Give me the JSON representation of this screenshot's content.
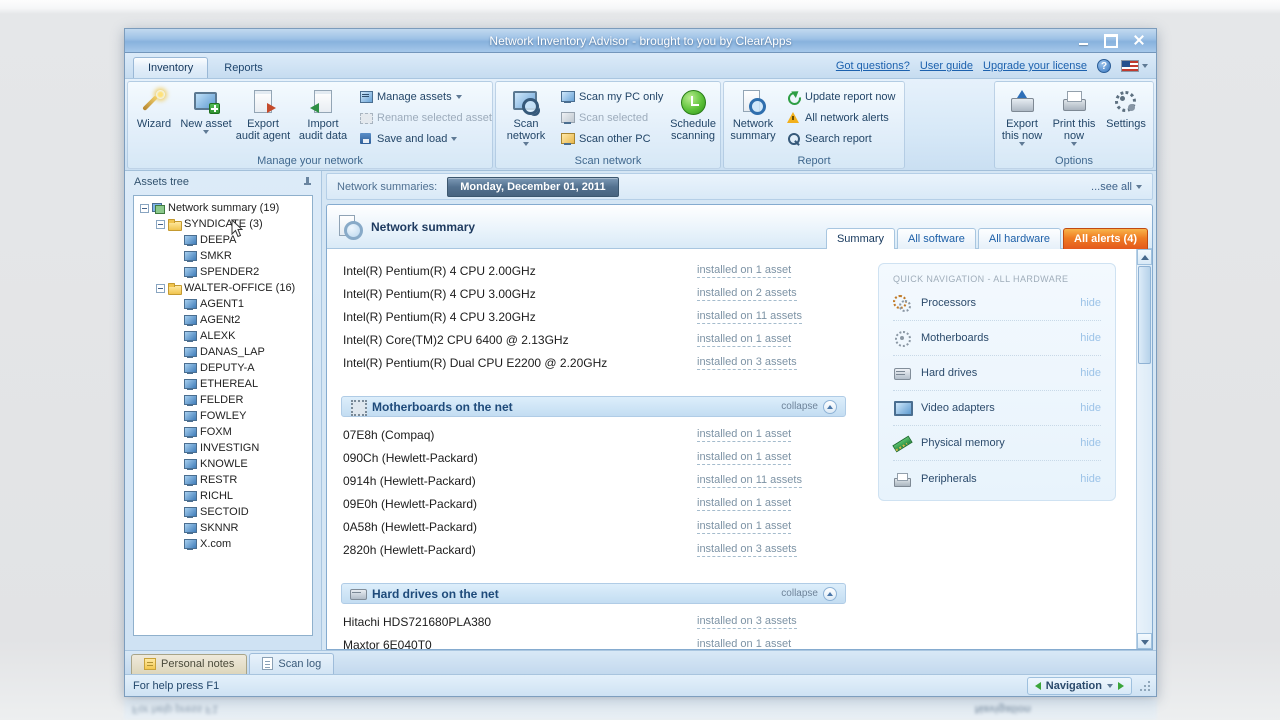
{
  "window": {
    "title": "Network Inventory Advisor - brought to you by ClearApps"
  },
  "header": {
    "tabs": [
      {
        "label": "Inventory"
      },
      {
        "label": "Reports"
      }
    ],
    "links": [
      "Got questions?",
      "User guide",
      "Upgrade your license"
    ]
  },
  "ribbon": {
    "manage": {
      "label": "Manage your network",
      "wizard": "Wizard",
      "new_asset": "New asset",
      "export_agent": "Export audit agent",
      "import_data": "Import audit data",
      "manage_assets": "Manage assets",
      "rename": "Rename selected asset",
      "save_load": "Save and load"
    },
    "scan": {
      "label": "Scan network",
      "scan_network": "Scan network",
      "my_pc": "Scan my PC only",
      "selected": "Scan selected",
      "other_pc": "Scan other PC",
      "schedule": "Schedule scanning"
    },
    "report": {
      "label": "Report",
      "network_summary": "Network summary",
      "update": "Update report now",
      "alerts": "All network alerts",
      "search": "Search report"
    },
    "options": {
      "label": "Options",
      "export": "Export this now",
      "print": "Print this now",
      "settings": "Settings"
    }
  },
  "assets_tree": {
    "title": "Assets tree",
    "items": [
      {
        "label": "Network summary (19)",
        "level": 0,
        "icon": "summary",
        "expand": true
      },
      {
        "label": "SYNDICATE (3)",
        "level": 1,
        "icon": "folder",
        "expand": true
      },
      {
        "label": "DEEPA",
        "level": 2,
        "icon": "pc",
        "expand": false
      },
      {
        "label": "SMKR",
        "level": 2,
        "icon": "pc",
        "expand": false
      },
      {
        "label": "SPENDER2",
        "level": 2,
        "icon": "pc",
        "expand": false
      },
      {
        "label": "WALTER-OFFICE (16)",
        "level": 1,
        "icon": "folder",
        "expand": true
      },
      {
        "label": "AGENT1",
        "level": 2,
        "icon": "pc",
        "expand": false
      },
      {
        "label": "AGENt2",
        "level": 2,
        "icon": "pc",
        "expand": false
      },
      {
        "label": "ALEXK",
        "level": 2,
        "icon": "pc",
        "expand": false
      },
      {
        "label": "DANAS_LAP",
        "level": 2,
        "icon": "pc",
        "expand": false
      },
      {
        "label": "DEPUTY-A",
        "level": 2,
        "icon": "pc",
        "expand": false
      },
      {
        "label": "ETHEREAL",
        "level": 2,
        "icon": "pc",
        "expand": false
      },
      {
        "label": "FELDER",
        "level": 2,
        "icon": "pc",
        "expand": false
      },
      {
        "label": "FOWLEY",
        "level": 2,
        "icon": "pc",
        "expand": false
      },
      {
        "label": "FOXM",
        "level": 2,
        "icon": "pc",
        "expand": false
      },
      {
        "label": "INVESTIGN",
        "level": 2,
        "icon": "pc",
        "expand": false
      },
      {
        "label": "KNOWLE",
        "level": 2,
        "icon": "pc",
        "expand": false
      },
      {
        "label": "RESTR",
        "level": 2,
        "icon": "pc",
        "expand": false
      },
      {
        "label": "RICHL",
        "level": 2,
        "icon": "pc",
        "expand": false
      },
      {
        "label": "SECTOID",
        "level": 2,
        "icon": "pc",
        "expand": false
      },
      {
        "label": "SKNNR",
        "level": 2,
        "icon": "pc",
        "expand": false
      },
      {
        "label": "X.com",
        "level": 2,
        "icon": "pc",
        "expand": false
      }
    ]
  },
  "summaries_bar": {
    "label": "Network summaries:",
    "date": "Monday, December 01, 2011",
    "see_all": "...see all"
  },
  "report_view": {
    "title": "Network summary",
    "tabs": [
      "Summary",
      "All software",
      "All hardware",
      "All alerts (4)"
    ],
    "processor_rows": [
      {
        "name": "Intel(R) Pentium(R) 4 CPU 2.00GHz",
        "installed": "installed on 1 asset"
      },
      {
        "name": "Intel(R) Pentium(R) 4 CPU 3.00GHz",
        "installed": "installed on 2 assets"
      },
      {
        "name": "Intel(R) Pentium(R) 4 CPU 3.20GHz",
        "installed": "installed on 11 assets"
      },
      {
        "name": "Intel(R) Core(TM)2 CPU 6400 @ 2.13GHz",
        "installed": "installed on 1 asset"
      },
      {
        "name": "Intel(R) Pentium(R) Dual CPU E2200 @ 2.20GHz",
        "installed": "installed on 3 assets"
      }
    ],
    "sections": [
      {
        "title": "Motherboards on the net",
        "collapse": "collapse",
        "rows": [
          {
            "name": "07E8h (Compaq)",
            "installed": "installed on 1 asset"
          },
          {
            "name": "090Ch (Hewlett-Packard)",
            "installed": "installed on 1 asset"
          },
          {
            "name": "0914h (Hewlett-Packard)",
            "installed": "installed on 11 assets"
          },
          {
            "name": "09E0h (Hewlett-Packard)",
            "installed": "installed on 1 asset"
          },
          {
            "name": "0A58h (Hewlett-Packard)",
            "installed": "installed on 1 asset"
          },
          {
            "name": "2820h (Hewlett-Packard)",
            "installed": "installed on 3 assets"
          }
        ]
      },
      {
        "title": "Hard drives on the net",
        "collapse": "collapse",
        "rows": [
          {
            "name": "Hitachi HDS721680PLA380",
            "installed": "installed on 3 assets"
          },
          {
            "name": "Maxtor 6E040T0",
            "installed": "installed on 1 asset"
          }
        ]
      }
    ],
    "quick_nav": {
      "title": "QUICK NAVIGATION - ALL HARDWARE",
      "hide_label": "hide",
      "items": [
        {
          "label": "Processors",
          "icon": "processors"
        },
        {
          "label": "Motherboards",
          "icon": "motherboards"
        },
        {
          "label": "Hard drives",
          "icon": "harddrives"
        },
        {
          "label": "Video adapters",
          "icon": "video"
        },
        {
          "label": "Physical memory",
          "icon": "memory"
        },
        {
          "label": "Peripherals",
          "icon": "peripherals"
        }
      ]
    }
  },
  "bottom": {
    "notes_tab": "Personal notes",
    "scanlog_tab": "Scan log",
    "status": "For help press F1",
    "navigation": "Navigation"
  }
}
